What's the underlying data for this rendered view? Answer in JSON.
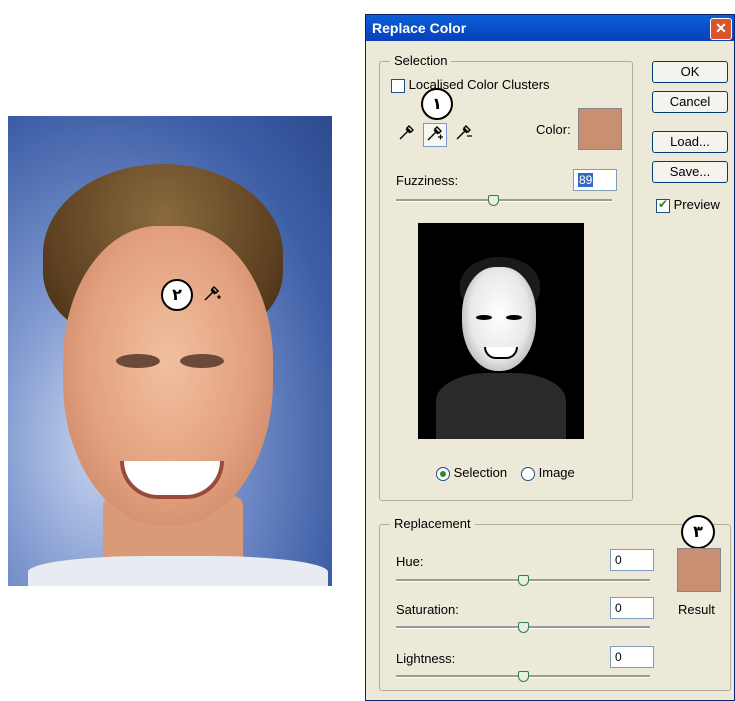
{
  "annotations": {
    "one": "۱",
    "two": "۲",
    "three": "۳"
  },
  "dialog": {
    "title": "Replace Color",
    "close_glyph": "✕",
    "buttons": {
      "ok": "OK",
      "cancel": "Cancel",
      "load": "Load...",
      "save": "Save..."
    },
    "preview": {
      "label": "Preview",
      "checked": true
    },
    "selection": {
      "legend": "Selection",
      "localized_label": "Localised Color Clusters",
      "color_label": "Color:",
      "fuzziness_label": "Fuzziness:",
      "fuzziness_value": "89",
      "fuzziness_fraction": 0.45,
      "radio_selection": "Selection",
      "radio_image": "Image",
      "selected_radio": "Selection"
    },
    "replacement": {
      "legend": "Replacement",
      "hue_label": "Hue:",
      "hue_value": "0",
      "saturation_label": "Saturation:",
      "saturation_value": "0",
      "lightness_label": "Lightness:",
      "lightness_value": "0",
      "result_label": "Result"
    }
  },
  "colors": {
    "sample": "#c98f72"
  },
  "icons": [
    "eyedropper-icon",
    "eyedropper-plus-icon",
    "eyedropper-minus-icon"
  ]
}
